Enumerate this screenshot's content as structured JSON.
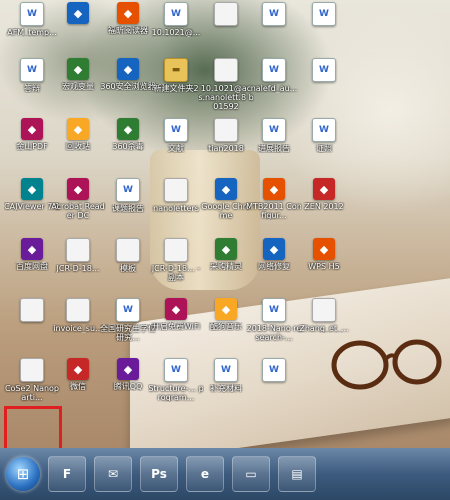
{
  "desktop": {
    "icons": [
      {
        "label": "AFM_temp...",
        "kind": "doc"
      },
      {
        "label": "",
        "kind": "app"
      },
      {
        "label": "福昕阅读器",
        "kind": "app"
      },
      {
        "label": "10.1021@...",
        "kind": "doc"
      },
      {
        "label": "",
        "kind": "blank"
      },
      {
        "label": "",
        "kind": "doc"
      },
      {
        "label": "",
        "kind": "doc"
      },
      {
        "label": "答辩",
        "kind": "doc"
      },
      {
        "label": "宏观变量",
        "kind": "app"
      },
      {
        "label": "360安全浏览器",
        "kind": "app"
      },
      {
        "label": "新建文件夹2",
        "kind": "folder"
      },
      {
        "label": "10.1021@ac s.nanolett.8 b01592",
        "kind": "blank"
      },
      {
        "label": "nalefd_au...",
        "kind": "doc"
      },
      {
        "label": "",
        "kind": "doc"
      },
      {
        "label": "金山PDF",
        "kind": "app"
      },
      {
        "label": "回收站",
        "kind": "app"
      },
      {
        "label": "360杀毒",
        "kind": "app"
      },
      {
        "label": "文献",
        "kind": "doc"
      },
      {
        "label": "tian2018",
        "kind": "blank"
      },
      {
        "label": "进展报告",
        "kind": "doc"
      },
      {
        "label": "证照",
        "kind": "doc"
      },
      {
        "label": "CAJViewer 7.1",
        "kind": "app"
      },
      {
        "label": "Acrobat Reader DC",
        "kind": "app"
      },
      {
        "label": "课题报告",
        "kind": "doc"
      },
      {
        "label": "nanoletters",
        "kind": "blank"
      },
      {
        "label": "Google Chrome",
        "kind": "app"
      },
      {
        "label": "MTB2011 Configur...",
        "kind": "app"
      },
      {
        "label": "ZEN 2012",
        "kind": "app"
      },
      {
        "label": "百度网盘",
        "kind": "app"
      },
      {
        "label": "JCR-D-18...",
        "kind": "blank"
      },
      {
        "label": "模板",
        "kind": "blank"
      },
      {
        "label": "JCR-D-18... - 副本",
        "kind": "blank"
      },
      {
        "label": "采购精灵",
        "kind": "app"
      },
      {
        "label": "网络修复",
        "kind": "app"
      },
      {
        "label": "WPS H5",
        "kind": "app"
      },
      {
        "label": "",
        "kind": "blank"
      },
      {
        "label": "invoice_su...",
        "kind": "blank"
      },
      {
        "label": "全国研究生学位研究...",
        "kind": "doc"
      },
      {
        "label": "开启免费WiFi",
        "kind": "app"
      },
      {
        "label": "酷狗音乐",
        "kind": "app"
      },
      {
        "label": "2018-Nano research-...",
        "kind": "doc"
      },
      {
        "label": "Zhang_et_...",
        "kind": "blank"
      },
      {
        "label": "CoSe2 Nanoparti...",
        "kind": "blank"
      },
      {
        "label": "微信",
        "kind": "app"
      },
      {
        "label": "腾讯QQ",
        "kind": "app"
      },
      {
        "label": "Structure-... program...",
        "kind": "doc"
      },
      {
        "label": "补充材料",
        "kind": "doc"
      },
      {
        "label": "",
        "kind": "doc"
      }
    ]
  },
  "taskbar": {
    "start_icon": "windows-start-icon",
    "buttons": [
      {
        "name": "foxit",
        "glyph": "F"
      },
      {
        "name": "wechat",
        "glyph": "✉"
      },
      {
        "name": "photoshop",
        "glyph": "Ps"
      },
      {
        "name": "360-browser",
        "glyph": "e"
      },
      {
        "name": "app",
        "glyph": "▭"
      },
      {
        "name": "explorer",
        "glyph": "▤"
      }
    ]
  },
  "colors": {
    "highlight": "#e02020",
    "taskbar": "#3d5b7e"
  }
}
